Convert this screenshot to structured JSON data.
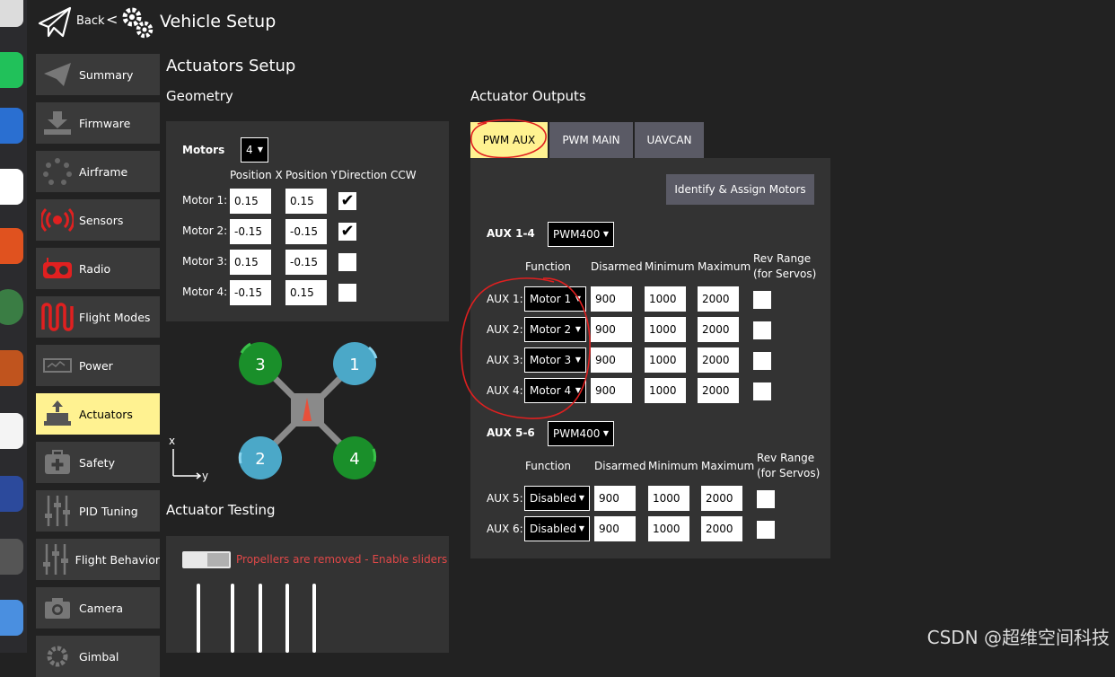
{
  "header": {
    "back_label": "Back",
    "chevron": "<",
    "title": "Vehicle Setup",
    "back_icon": "paper-plane-icon",
    "gear_icon": "gears-icon"
  },
  "sidebar": {
    "items": [
      {
        "label": "Summary",
        "icon": "plane-icon"
      },
      {
        "label": "Firmware",
        "icon": "download-icon"
      },
      {
        "label": "Airframe",
        "icon": "airframe-icon"
      },
      {
        "label": "Sensors",
        "icon": "radio-waves-icon"
      },
      {
        "label": "Radio",
        "icon": "radio-transmitter-icon"
      },
      {
        "label": "Flight Modes",
        "icon": "wave-icon"
      },
      {
        "label": "Power",
        "icon": "battery-icon"
      },
      {
        "label": "Actuators",
        "icon": "actuator-icon",
        "active": true
      },
      {
        "label": "Safety",
        "icon": "medkit-icon"
      },
      {
        "label": "PID Tuning",
        "icon": "sliders-icon"
      },
      {
        "label": "Flight Behavior",
        "icon": "sliders-icon"
      },
      {
        "label": "Camera",
        "icon": "camera-icon"
      },
      {
        "label": "Gimbal",
        "icon": "gimbal-icon"
      }
    ]
  },
  "main": {
    "title": "Actuators Setup",
    "geometry": {
      "heading": "Geometry",
      "motors_label": "Motors",
      "motors_count": "4",
      "columns": [
        "Position X",
        "Position Y",
        "Direction CCW"
      ],
      "rows": [
        {
          "label": "Motor 1:",
          "x": "0.15",
          "y": "0.15",
          "ccw": "✔"
        },
        {
          "label": "Motor 2:",
          "x": "-0.15",
          "y": "-0.15",
          "ccw": "✔"
        },
        {
          "label": "Motor 3:",
          "x": "0.15",
          "y": "-0.15",
          "ccw": ""
        },
        {
          "label": "Motor 4:",
          "x": "-0.15",
          "y": "0.15",
          "ccw": ""
        }
      ],
      "diagram": {
        "rotor_labels": [
          "3",
          "1",
          "2",
          "4"
        ],
        "axis_x": "x",
        "axis_y": "y",
        "colors": {
          "cw": "#1a8f2a",
          "ccw": "#4ba8c8",
          "body": "#888888",
          "arrow": "#e8503a"
        }
      }
    },
    "testing": {
      "heading": "Actuator Testing",
      "warning": "Propellers are removed - Enable sliders",
      "warning_color": "#e04848",
      "slider_count": 5
    },
    "outputs": {
      "heading": "Actuator Outputs",
      "tabs": [
        "PWM AUX",
        "PWM MAIN",
        "UAVCAN"
      ],
      "active_tab": "PWM AUX",
      "identify_button": "Identify & Assign Motors",
      "groups": [
        {
          "label": "AUX 1-4",
          "rate": "PWM400",
          "columns": [
            "Function",
            "Disarmed",
            "Minimum",
            "Maximum",
            "Rev Range",
            "(for Servos)"
          ],
          "rows": [
            {
              "label": "AUX 1:",
              "function": "Motor 1",
              "disarmed": "900",
              "min": "1000",
              "max": "2000"
            },
            {
              "label": "AUX 2:",
              "function": "Motor 2",
              "disarmed": "900",
              "min": "1000",
              "max": "2000"
            },
            {
              "label": "AUX 3:",
              "function": "Motor 3",
              "disarmed": "900",
              "min": "1000",
              "max": "2000"
            },
            {
              "label": "AUX 4:",
              "function": "Motor 4",
              "disarmed": "900",
              "min": "1000",
              "max": "2000"
            }
          ]
        },
        {
          "label": "AUX 5-6",
          "rate": "PWM400",
          "columns": [
            "Function",
            "Disarmed",
            "Minimum",
            "Maximum",
            "Rev Range",
            "(for Servos)"
          ],
          "rows": [
            {
              "label": "AUX 5:",
              "function": "Disabled",
              "disarmed": "900",
              "min": "1000",
              "max": "2000"
            },
            {
              "label": "AUX 6:",
              "function": "Disabled",
              "disarmed": "900",
              "min": "1000",
              "max": "2000"
            }
          ]
        }
      ]
    }
  },
  "annotation_color": "#e02020",
  "watermark": "CSDN @超维空间科技"
}
